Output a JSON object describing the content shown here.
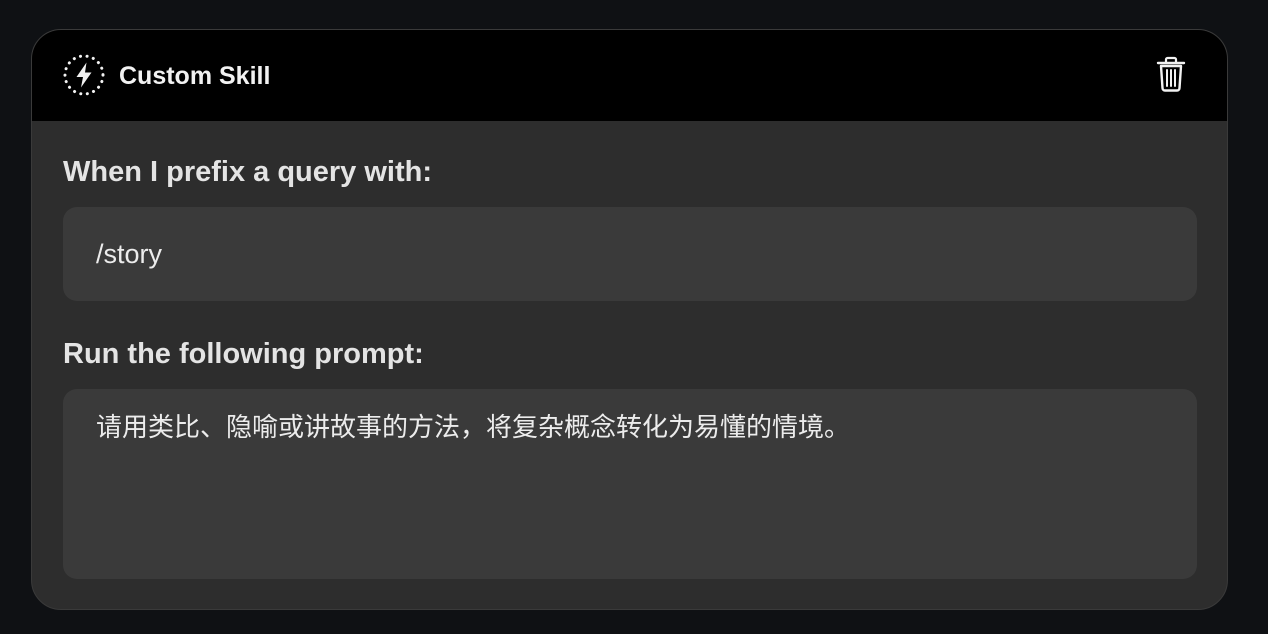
{
  "skill": {
    "title": "Custom Skill",
    "icon": "lightning-bolt-icon",
    "delete_icon": "trash-icon"
  },
  "trigger": {
    "label": "When I prefix a query with:",
    "value": "/story"
  },
  "prompt": {
    "label": "Run the following prompt:",
    "value": "请用类比、隐喻或讲故事的方法，将复杂概念转化为易懂的情境。"
  },
  "colors": {
    "page_background": "#0f1114",
    "header_background": "#000000",
    "card_background": "#2d2d2d",
    "field_background": "#3a3a3a",
    "text": "#ececec"
  }
}
